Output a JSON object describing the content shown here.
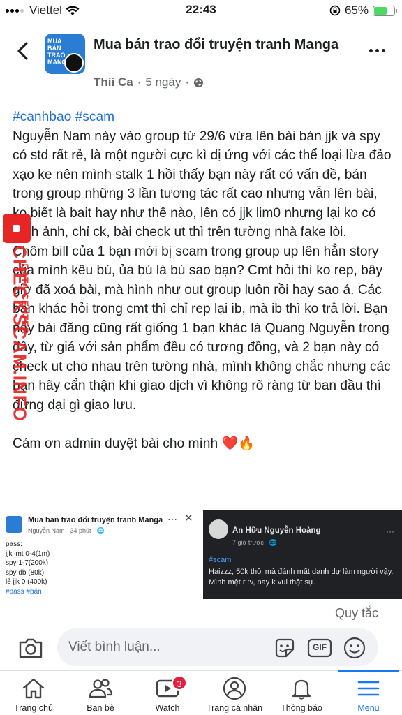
{
  "status_bar": {
    "carrier": "Viettel",
    "time": "22:43",
    "battery": "65%",
    "battery_level": 0.65
  },
  "header": {
    "group_title": "Mua bán trao đổi truyện tranh Manga",
    "author": "Thii Ca",
    "time_ago": "5 ngày",
    "avatar_text": "MUA BÁN TRAO MANGA"
  },
  "post": {
    "hashtags": "#canhbao #scam",
    "paragraph1": "Nguyễn Nam này vào group từ 29/6 vừa lên bài bán jjk và spy có std rất rẻ, là một người cực kì dị ứng với các thể loại lừa đảo xạo ke nên mình stalk 1 hồi thấy bạn này rất có vấn đề, bán trong group những 3 lần tương tác rất cao nhưng vẫn lên bài, ko biết là bait hay như thế nào, lên có jjk lim0 nhưng lại ko có hình ảnh, chỉ ck, bài check ut thì trên tường nhà fake lòi.",
    "paragraph2": "Chôm bill của 1 bạn mới bị scam trong group up lên hẳn story của mình kêu bú, ủa bú là bú sao bạn? Cmt hỏi thì ko rep, bây giờ đã xoá bài, mà hình như out group luôn rồi hay sao á. Các bạn khác hỏi trong cmt thì chỉ rep lại ib, mà ib thì ko trả lời. Bạn này bài đăng cũng rất giống 1 bạn khác là Quang Nguyễn trong đây, từ giá với sản phẩm đều có tương đồng, và 2 bạn này có check ut cho nhau trên tường nhà, mình không chắc nhưng các bạn hãy cẩn thận khi giao dịch vì không rõ ràng từ ban đầu thì đừng dại gì giao lưu.",
    "closing": "Cám ơn admin duyệt bài cho mình ❤️🔥"
  },
  "watermark": {
    "main": "CHECKSCAM.INFO",
    "sub": "DATA CENTER"
  },
  "image_left": {
    "title": "Mua bán trao đổi truyện tranh Manga",
    "meta": "Nguyễn Nam · 34 phút · 🌐",
    "lines": [
      "pass:",
      "jjk lmt 0-4(1m)",
      "spy 1-7(200k)",
      "spy đb (80k)",
      "lẻ jjk 0 (400k)"
    ],
    "tag": "#pass #bán"
  },
  "image_right": {
    "name": "An Hữu Nguyễn Hoàng",
    "meta": "7 giờ trước · 🌐",
    "tag": "#scam",
    "text": "Haizzz, 50k thôi mà đánh mất danh dự làm người vậy. Mình mệt r :v, nay k vui thật sự."
  },
  "rules_link": "Quy tắc",
  "comment": {
    "placeholder": "Viết bình luận...",
    "gif_label": "GIF"
  },
  "nav": {
    "home": "Trang chủ",
    "friends": "Bạn bè",
    "watch": "Watch",
    "watch_badge": "3",
    "profile": "Trang cá nhân",
    "notifications": "Thông báo",
    "menu": "Menu"
  },
  "colors": {
    "accent": "#1877f2",
    "hashtag": "#216fdb",
    "badge": "#e41e3f",
    "watermark": "#e62525"
  }
}
